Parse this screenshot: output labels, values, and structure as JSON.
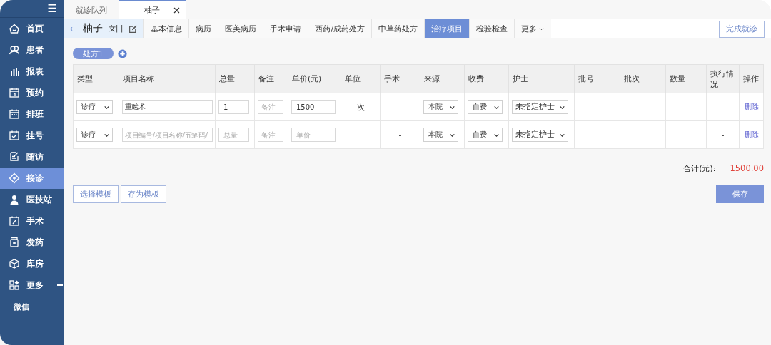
{
  "sidebar": {
    "menu_icon": "☰",
    "items": [
      {
        "label": "首页",
        "selected": false
      },
      {
        "label": "患者",
        "selected": false
      },
      {
        "label": "报表",
        "selected": false
      },
      {
        "label": "预约",
        "selected": false
      },
      {
        "label": "排班",
        "selected": false
      },
      {
        "label": "挂号",
        "selected": false
      },
      {
        "label": "随访",
        "selected": false
      },
      {
        "label": "接诊",
        "selected": true
      },
      {
        "label": "医技站",
        "selected": false
      },
      {
        "label": "手术",
        "selected": false
      },
      {
        "label": "发药",
        "selected": false
      },
      {
        "label": "库房",
        "selected": false
      },
      {
        "label": "更多",
        "selected": false,
        "expanded": true,
        "children": [
          {
            "label": "微信"
          }
        ]
      }
    ]
  },
  "top_tabs": [
    {
      "label": "就诊队列",
      "selected": false,
      "closable": false
    },
    {
      "label": "柚子",
      "selected": true,
      "closable": true
    }
  ],
  "patient": {
    "back": "←",
    "name": "柚子",
    "info": "女|-|"
  },
  "nav_tabs": [
    {
      "label": "基本信息",
      "selected": false
    },
    {
      "label": "病历",
      "selected": false
    },
    {
      "label": "医美病历",
      "selected": false
    },
    {
      "label": "手术申请",
      "selected": false
    },
    {
      "label": "西药/成药处方",
      "selected": false
    },
    {
      "label": "中草药处方",
      "selected": false
    },
    {
      "label": "治疗项目",
      "selected": true
    },
    {
      "label": "检验检查",
      "selected": false
    },
    {
      "label": "更多",
      "selected": false,
      "kind": "dropdown"
    }
  ],
  "finish_button": "完成就诊",
  "prescriptions": [
    {
      "label": "处方1",
      "selected": true
    }
  ],
  "table": {
    "columns": [
      "类型",
      "项目名称",
      "总量",
      "备注",
      "单价(元)",
      "单位",
      "手术",
      "来源",
      "收费",
      "护士",
      "批号",
      "批次",
      "数量",
      "执行情况",
      "操作"
    ],
    "rows": [
      {
        "type": "诊疗",
        "name": {
          "value": "重睑术"
        },
        "total": {
          "value": "1"
        },
        "note": {
          "placeholder": "备注"
        },
        "price": {
          "value": "1500"
        },
        "unit": "次",
        "surgery": "-",
        "source": "本院",
        "fee": "自费",
        "nurse": "未指定护士",
        "exec": "-",
        "action": "删除"
      },
      {
        "type": "诊疗",
        "name": {
          "placeholder": "项目编号/项目名称/五笔码/"
        },
        "total": {
          "placeholder": "总量"
        },
        "note": {
          "placeholder": "备注"
        },
        "price": {
          "placeholder": "单价"
        },
        "surgery": "-",
        "source": "本院",
        "fee": "自费",
        "nurse": "未指定护士",
        "exec": "-",
        "action": "删除"
      }
    ]
  },
  "total": {
    "label": "合计(元):",
    "value": "1500.00"
  },
  "buttons": {
    "left": [
      "选择模板",
      "存为模板"
    ],
    "save": "保存"
  }
}
